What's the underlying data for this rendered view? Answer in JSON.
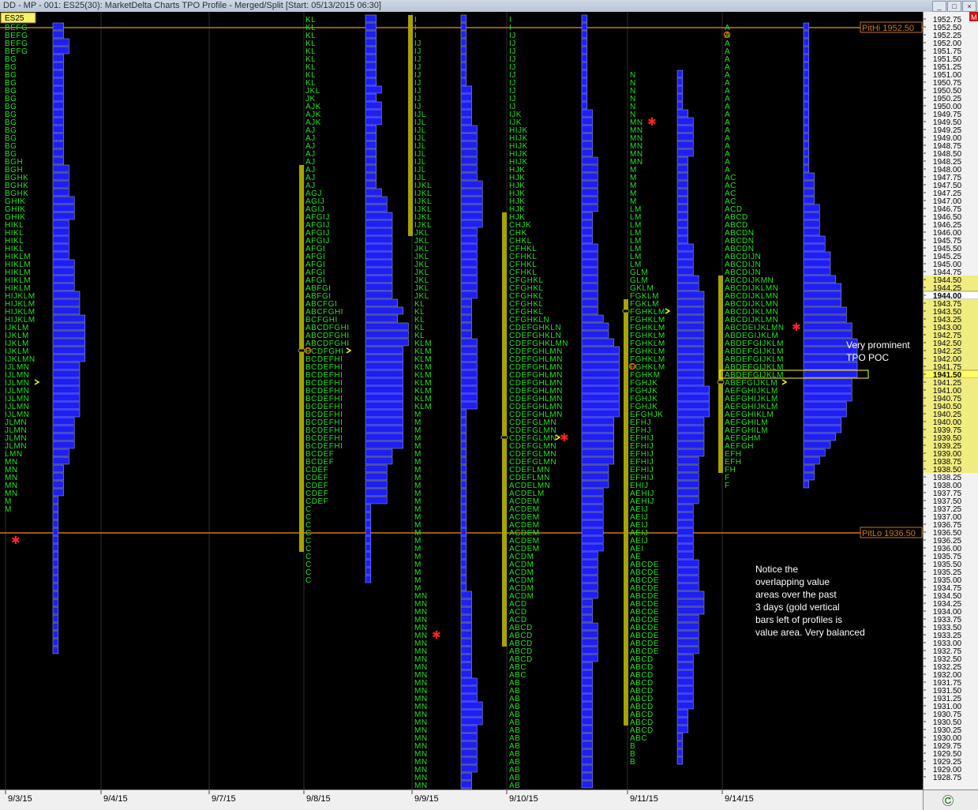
{
  "window": {
    "title": "DD - MP - 001: ES25(30): MarketDelta Charts TPO Profile - Merged/Split [Start: 05/13/2015 06:30]",
    "symbol_badge": "ES25",
    "buttons": [
      "_",
      "□",
      "×"
    ]
  },
  "colors": {
    "tpo_letters": "#21e321",
    "histogram": "#1f1ff2",
    "histogram_edge": "#9fb0ff",
    "value_area_bar": "#a7a300",
    "pit_line": "#c8781e",
    "poc_marker": "#ffff00",
    "single_print_marker": "#ff2222",
    "open_marker": "#ff5500",
    "price_highlight": "#f0ec80"
  },
  "pit_lines": {
    "high": {
      "label": "PitHi 1952.50",
      "price": 1952.5
    },
    "low": {
      "label": "PitLo 1936.50",
      "price": 1936.5
    }
  },
  "price_axis": {
    "labels": [
      "1952.75",
      "1952.50",
      "1952.25",
      "1952.00",
      "1951.75",
      "1951.50",
      "1951.25",
      "1951.00",
      "1950.75",
      "1950.50",
      "1950.25",
      "1950.00",
      "1949.75",
      "1949.50",
      "1949.25",
      "1949.00",
      "1948.75",
      "1948.50",
      "1948.25",
      "1948.00",
      "1947.75",
      "1947.50",
      "1947.25",
      "1947.00",
      "1946.75",
      "1946.50",
      "1946.25",
      "1946.00",
      "1945.75",
      "1945.50",
      "1945.25",
      "1945.00",
      "1944.75",
      "1944.50",
      "1944.25",
      "1944.00",
      "1943.75",
      "1943.50",
      "1943.25",
      "1943.00",
      "1942.75",
      "1942.50",
      "1942.25",
      "1942.00",
      "1941.75",
      "1941.50",
      "1941.25",
      "1941.00",
      "1940.75",
      "1940.50",
      "1940.25",
      "1940.00",
      "1939.75",
      "1939.50",
      "1939.25",
      "1939.00",
      "1938.75",
      "1938.50",
      "1938.25",
      "1938.00",
      "1937.75",
      "1937.50",
      "1937.25",
      "1937.00",
      "1936.75",
      "1936.50",
      "1936.25",
      "1936.00",
      "1935.75",
      "1935.50",
      "1935.25",
      "1935.00",
      "1934.75",
      "1934.50",
      "1934.25",
      "1934.00",
      "1933.75",
      "1933.50",
      "1933.25",
      "1933.00",
      "1932.75",
      "1932.50",
      "1932.25",
      "1932.00",
      "1931.75",
      "1931.50",
      "1931.25",
      "1931.00",
      "1930.75",
      "1930.50",
      "1930.25",
      "1930.00",
      "1929.75",
      "1929.50",
      "1929.25",
      "1929.00",
      "1928.75"
    ],
    "current_price": "1944.00",
    "poc_price": "1941.50",
    "highlight_from": "1944.50",
    "highlight_to": "1938.50"
  },
  "date_axis": {
    "labels": [
      {
        "text": "9/3/15",
        "session": 0
      },
      {
        "text": "9/4/15",
        "session": 1
      },
      {
        "text": "9/7/15",
        "session": 2
      },
      {
        "text": "9/8/15",
        "session": 3
      },
      {
        "text": "9/9/15",
        "session": 4
      },
      {
        "text": "9/10/15",
        "session": 5
      },
      {
        "text": "9/11/15",
        "session": 6
      },
      {
        "text": "9/14/15",
        "session": 7
      }
    ]
  },
  "annotations": [
    {
      "lines": [
        "Very prominent",
        "TPO POC"
      ]
    },
    {
      "lines": [
        "Notice the",
        "overlapping value",
        "areas over the past",
        "3 days (gold vertical",
        "bars left of profiles is",
        "value area.  Very balanced"
      ]
    }
  ],
  "sessions": [
    {
      "date": "9/3/15",
      "top": 1952.5,
      "letters_visible": false,
      "rows": [
        "BEFG",
        "BEFG",
        "BEFG",
        "BEFG",
        "BG",
        "BG",
        "BG",
        "BG",
        "BG",
        "BG",
        "BG",
        "BG",
        "BG",
        "BG",
        "BG",
        "BG",
        "BG",
        "BGH",
        "BGH",
        "BGHK",
        "BGHK",
        "BGHK",
        "GHIK",
        "GHIK",
        "GHIK",
        "HIKL",
        "HIKL",
        "HIKL",
        "HIKL",
        "HIKLM",
        "HIKLM",
        "HIKLM",
        "HIKLM",
        "HIKLM",
        "HIJKLM",
        "HIJKLM",
        "HIJKLM",
        "HIJKLM",
        "IJKLM",
        "IJKLM",
        "IJKLM",
        "IJKLM",
        "IJKLMN",
        "IJLMN",
        "IJLMN",
        "IJLMN",
        "IJLMN",
        "IJLMN",
        "IJLMN",
        "IJLMN",
        "JLMN",
        "JLMN",
        "JLMN",
        "JLMN",
        "LMN",
        "MN",
        "MN",
        "MN",
        "MN",
        "MN",
        "M",
        "M"
      ],
      "hist": [
        2,
        2,
        3,
        3,
        2,
        2,
        2,
        2,
        2,
        2,
        2,
        2,
        2,
        2,
        2,
        2,
        2,
        2,
        3,
        3,
        3,
        3,
        4,
        4,
        4,
        3,
        3,
        3,
        3,
        3,
        4,
        4,
        4,
        4,
        5,
        5,
        5,
        6,
        6,
        6,
        6,
        6,
        6,
        5,
        5,
        5,
        5,
        5,
        5,
        5,
        4,
        4,
        4,
        4,
        3,
        3,
        2,
        2,
        2,
        2,
        1,
        1,
        1,
        1,
        1,
        1,
        1,
        1,
        1,
        1,
        1,
        1,
        1,
        1,
        1,
        1,
        1,
        1,
        1,
        1
      ],
      "poc_row": 45,
      "va": null,
      "open_row": null,
      "single_row": 65
    },
    {
      "date": "9/8/15",
      "top": 1952.75,
      "rows": [
        "KL",
        "KL",
        "KL",
        "KL",
        "KL",
        "KL",
        "KL",
        "KL",
        "KL",
        "JKL",
        "JK",
        "AJK",
        "AJK",
        "AJK",
        "AJ",
        "AJ",
        "AJ",
        "AJ",
        "AJ",
        "AJ",
        "AJ",
        "AJ",
        "AGJ",
        "AGIJ",
        "AGIJ",
        "AFGIJ",
        "AFGIJ",
        "AFGIJ",
        "AFGIJ",
        "AFGI",
        "AFGI",
        "AFGI",
        "AFGI",
        "AFGI",
        "ABFGI",
        "ABFGI",
        "ABCFGI",
        "ABCFGHI",
        "BCFGHI",
        "ABCDFGHI",
        "ABCDFGHI",
        "ABCDFGHI",
        "BCDFGHI",
        "BCDEFHI",
        "BCDEFHI",
        "BCDEFHI",
        "BCDEFHI",
        "BCDEFHI",
        "BCDEFHI",
        "BCDEFHI",
        "BCDEFHI",
        "BCDEFHI",
        "BCDEFHI",
        "BCDEFHI",
        "BCDEFHI",
        "BCDEF",
        "BCDEF",
        "CDEF",
        "CDEF",
        "CDEF",
        "CDEF",
        "CDEF",
        "C",
        "C",
        "C",
        "C",
        "C",
        "C",
        "C",
        "C",
        "C",
        "C"
      ],
      "hist": [
        2,
        2,
        2,
        2,
        2,
        2,
        2,
        2,
        2,
        3,
        2,
        3,
        3,
        3,
        2,
        2,
        2,
        2,
        2,
        2,
        2,
        2,
        3,
        4,
        4,
        5,
        5,
        5,
        5,
        5,
        5,
        5,
        5,
        5,
        5,
        5,
        6,
        7,
        6,
        8,
        8,
        8,
        7,
        7,
        7,
        7,
        7,
        7,
        7,
        7,
        7,
        7,
        7,
        7,
        7,
        5,
        5,
        4,
        4,
        4,
        4,
        4,
        1,
        1,
        1,
        1,
        1,
        1,
        1,
        1,
        1,
        1
      ],
      "poc_row": 42,
      "va": [
        19,
        67
      ],
      "open_row": 42,
      "single_row": null
    },
    {
      "date": "9/9/15",
      "top": 1952.75,
      "rows": [
        "I",
        "I",
        "I",
        "IJ",
        "IJ",
        "IJ",
        "IJ",
        "IJ",
        "IJ",
        "IJ",
        "IJ",
        "IJ",
        "IJL",
        "IJL",
        "IJL",
        "IJL",
        "IJL",
        "IJL",
        "IJL",
        "IJL",
        "IJL",
        "IJKL",
        "IJKL",
        "IJKL",
        "IJKL",
        "IJKL",
        "IJKL",
        "JKL",
        "JKL",
        "JKL",
        "JKL",
        "JKL",
        "JKL",
        "JKL",
        "JKL",
        "JKL",
        "KL",
        "KL",
        "KL",
        "KL",
        "KL",
        "KLM",
        "KLM",
        "KLM",
        "KLM",
        "KLM",
        "KLM",
        "KLM",
        "KLM",
        "KLM",
        "M",
        "M",
        "M",
        "M",
        "M",
        "M",
        "M",
        "M",
        "M",
        "M",
        "M",
        "M",
        "M",
        "M",
        "M",
        "M",
        "M",
        "M",
        "M",
        "M",
        "M",
        "M",
        "M",
        "MN",
        "MN",
        "MN",
        "MN",
        "MN",
        "MN",
        "MN",
        "MN",
        "MN",
        "MN",
        "MN",
        "MN",
        "MN",
        "MN",
        "MN",
        "MN",
        "MN",
        "MN",
        "MN",
        "MN",
        "MN",
        "MN",
        "MN",
        "MN",
        "MN",
        "MN",
        "MN",
        "M",
        "M",
        "M",
        "M"
      ],
      "hist": [
        1,
        1,
        1,
        1,
        1,
        1,
        1,
        1,
        1,
        2,
        2,
        2,
        2,
        2,
        3,
        3,
        3,
        3,
        3,
        3,
        3,
        4,
        4,
        4,
        4,
        4,
        4,
        3,
        3,
        3,
        3,
        3,
        3,
        3,
        3,
        3,
        2,
        2,
        2,
        2,
        2,
        3,
        3,
        3,
        3,
        3,
        3,
        3,
        3,
        3,
        1,
        1,
        1,
        1,
        1,
        1,
        1,
        1,
        1,
        1,
        1,
        1,
        1,
        1,
        1,
        1,
        1,
        1,
        1,
        1,
        1,
        1,
        1,
        2,
        2,
        2,
        2,
        2,
        2,
        2,
        2,
        2,
        2,
        2,
        3,
        3,
        3,
        4,
        4,
        4,
        3,
        3,
        3,
        3,
        3,
        3,
        2,
        2,
        2,
        2,
        2,
        2,
        2
      ],
      "poc_row": null,
      "va": [
        0,
        27
      ],
      "open_row": null,
      "single_row": 78
    },
    {
      "date": "9/10/15",
      "top": 1952.75,
      "rows": [
        "I",
        "I",
        "IJ",
        "IJ",
        "IJ",
        "IJ",
        "IJ",
        "IJ",
        "IJ",
        "IJ",
        "IJ",
        "IJ",
        "IJK",
        "IJK",
        "HIJK",
        "HIJK",
        "HIJK",
        "HIJK",
        "HIJK",
        "HJK",
        "HJK",
        "HJK",
        "HJK",
        "HJK",
        "HJK",
        "HJK",
        "CHJK",
        "CHK",
        "CHKL",
        "CFHKL",
        "CFHKL",
        "CFHKL",
        "CFHKL",
        "CFGHKL",
        "CFGHKL",
        "CFGHKL",
        "CFGHKL",
        "CFGHKL",
        "CFGHKLN",
        "CDEFGHKLN",
        "CDEFGHKLN",
        "CDEFGHKLMN",
        "CDEFGHLMN",
        "CDEFGHLMN",
        "CDEFGHLMN",
        "CDEFGHLMN",
        "CDEFGHLMN",
        "CDEFGHLMN",
        "CDEFGHLMN",
        "CDEFGHLMN",
        "CDEFGHLMN",
        "CDEFGLMN",
        "CDEFGLMN",
        "CDEFGLMN",
        "CDEFGLMN",
        "CDEFGLMN",
        "CDEFGLMN",
        "CDEFLMN",
        "CDEFLMN",
        "ACDELMN",
        "ACDELM",
        "ACDEM",
        "ACDEM",
        "ACDEM",
        "ACDEM",
        "ACDEM",
        "ACDEM",
        "ACDEM",
        "ACDM",
        "ACDM",
        "ACDM",
        "ACDM",
        "ACDM",
        "ACDM",
        "ACD",
        "ACD",
        "ACD",
        "ABCD",
        "ABCD",
        "ABCD",
        "ABCD",
        "ABCD",
        "ABC",
        "ABC",
        "AB",
        "AB",
        "AB",
        "AB",
        "AB",
        "AB",
        "AB",
        "AB",
        "AB",
        "AB",
        "AB",
        "AB",
        "AB",
        "AB"
      ],
      "hist": [
        1,
        1,
        1,
        1,
        1,
        1,
        1,
        1,
        1,
        1,
        1,
        1,
        2,
        2,
        2,
        2,
        2,
        2,
        3,
        3,
        3,
        3,
        3,
        3,
        3,
        2,
        2,
        2,
        2,
        3,
        3,
        3,
        3,
        3,
        3,
        3,
        3,
        3,
        4,
        5,
        5,
        6,
        7,
        7,
        7,
        7,
        7,
        7,
        7,
        7,
        7,
        6,
        6,
        6,
        6,
        6,
        6,
        5,
        5,
        5,
        4,
        4,
        4,
        4,
        4,
        4,
        4,
        4,
        3,
        3,
        3,
        3,
        3,
        3,
        2,
        2,
        2,
        3,
        3,
        3,
        3,
        3,
        2,
        2,
        2,
        2,
        2,
        2,
        2,
        2,
        2,
        2,
        2,
        2,
        2,
        2,
        2,
        2
      ],
      "poc_row": 53,
      "va": [
        25,
        79
      ],
      "open_row": null,
      "single_row": 53
    },
    {
      "date": "9/11/15",
      "top": 1951.0,
      "rows": [
        "N",
        "N",
        "N",
        "N",
        "N",
        "N",
        "MN",
        "MN",
        "MN",
        "MN",
        "MN",
        "MN",
        "M",
        "M",
        "M",
        "M",
        "M",
        "LM",
        "LM",
        "LM",
        "LM",
        "LM",
        "LM",
        "LM",
        "LM",
        "GLM",
        "GLM",
        "GKLM",
        "FGKLM",
        "FGKLM",
        "FGHKLM",
        "FGHKLM",
        "FGHKLM",
        "FGHKLM",
        "FGHKLM",
        "FGHKLM",
        "FGHKLM",
        "FGHKLM",
        "FGHKM",
        "FGHJK",
        "FGHJK",
        "FGHJK",
        "FGHJK",
        "EFGHJK",
        "EFHJ",
        "EFHJ",
        "EFHIJ",
        "EFHIJ",
        "EFHIJ",
        "EFHIJ",
        "EFHIJ",
        "EFHIJ",
        "EHIJ",
        "AEHIJ",
        "AEHIJ",
        "AEIJ",
        "AEIJ",
        "AEIJ",
        "AEIJ",
        "AEIJ",
        "AEI",
        "AE",
        "ABCDE",
        "ABCDE",
        "ABCDE",
        "ABCDE",
        "ABCDE",
        "ABCDE",
        "ABCDE",
        "ABCDE",
        "ABCDE",
        "ABCDE",
        "ABCDE",
        "ABCDE",
        "ABCD",
        "ABCD",
        "ABCD",
        "ABCD",
        "ABCD",
        "ABCD",
        "ABCD",
        "ABCD",
        "ABCD",
        "ABCD",
        "ABC",
        "B",
        "B",
        "B"
      ],
      "hist": [
        1,
        1,
        1,
        1,
        1,
        2,
        3,
        3,
        3,
        3,
        3,
        2,
        2,
        2,
        2,
        2,
        2,
        2,
        2,
        2,
        2,
        2,
        3,
        3,
        3,
        3,
        4,
        4,
        5,
        5,
        5,
        5,
        5,
        5,
        5,
        5,
        5,
        5,
        5,
        5,
        6,
        6,
        6,
        6,
        5,
        5,
        5,
        5,
        5,
        4,
        4,
        4,
        4,
        4,
        4,
        3,
        3,
        3,
        3,
        3,
        3,
        3,
        4,
        4,
        4,
        4,
        5,
        5,
        5,
        4,
        4,
        4,
        4,
        4,
        3,
        3,
        3,
        3,
        3,
        3,
        3,
        2,
        2,
        2,
        1,
        1,
        1,
        1
      ],
      "poc_row": 30,
      "va": [
        29,
        82
      ],
      "open_row": 37,
      "single_row": 6
    },
    {
      "date": "9/14/15",
      "top": 1952.5,
      "rows": [
        "A",
        "A",
        "A",
        "A",
        "A",
        "A",
        "A",
        "A",
        "A",
        "A",
        "A",
        "A",
        "A",
        "A",
        "A",
        "A",
        "A",
        "A",
        "A",
        "AC",
        "AC",
        "AC",
        "AC",
        "ACD",
        "ABCD",
        "ABCD",
        "ABCDN",
        "ABCDN",
        "ABCDN",
        "ABCDIJN",
        "ABCDIJN",
        "ABCDIJN",
        "ABCDIJKMN",
        "ABCDIJKLMN",
        "ABCDIJKLMN",
        "ABCDIJKLMN",
        "ABCDIJKLMN",
        "ABCDIJKLMN",
        "ABCDEIJKLMN",
        "ABDEGIJKLM",
        "ABDEFGIJKLM",
        "ABDEFGIJKLM",
        "ABDEFGIJKLM",
        "ABDEFGIJKLM",
        "ABDEFGIJKLM",
        "ABEFGIJKLM",
        "AEFGHIJKLM",
        "AEFGHIJKLM",
        "AEFGHIJKLM",
        "AEFGHIKLM",
        "AEFGHILM",
        "AEFGHILM",
        "AEFGHM",
        "AEFGH",
        "EFH",
        "EFH",
        "FH",
        "F",
        "F"
      ],
      "hist": [
        1,
        1,
        1,
        1,
        1,
        1,
        1,
        1,
        1,
        1,
        1,
        1,
        1,
        1,
        1,
        1,
        1,
        1,
        1,
        2,
        2,
        2,
        2,
        3,
        3,
        3,
        3,
        4,
        4,
        5,
        5,
        5,
        6,
        7,
        7,
        7,
        8,
        8,
        9,
        9,
        10,
        10,
        10,
        10,
        10,
        9,
        9,
        9,
        8,
        8,
        7,
        7,
        6,
        5,
        4,
        3,
        2,
        2,
        1
      ],
      "poc_row": 45,
      "va": [
        32,
        56
      ],
      "open_row": 1,
      "single_row": 38
    }
  ]
}
